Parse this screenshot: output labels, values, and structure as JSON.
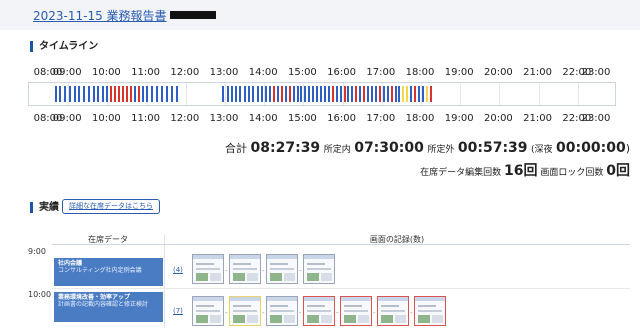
{
  "header": {
    "report_title": "2023-11-15 業務報告書"
  },
  "timeline": {
    "section_title": "タイムライン",
    "hours": [
      "08:00",
      "09:00",
      "10:00",
      "11:00",
      "12:00",
      "13:00",
      "14:00",
      "15:00",
      "16:00",
      "17:00",
      "18:00",
      "19:00",
      "20:00",
      "21:00",
      "22:00",
      "23:00"
    ],
    "stripe_colors": {
      "blue": "#2f5ec4",
      "red": "#d9342b",
      "yellow": "#f2d64b"
    }
  },
  "summary": {
    "total_label": "合計",
    "total_value": "08:27:39",
    "in_hours_label": "所定内",
    "in_hours_value": "07:30:00",
    "out_hours_label": "所定外",
    "out_hours_value": "00:57:39",
    "night_prefix": "(深夜",
    "night_value": "00:00:00",
    "night_suffix": ")",
    "edit_label": "在席データ編集回数",
    "edit_value": "16回",
    "lock_label": "画面ロック回数",
    "lock_value": "0回"
  },
  "results": {
    "section_title": "実績",
    "detail_link": "詳細な在席データはこちら",
    "col_presence": "在席データ",
    "col_screens": "画面の記録(数)",
    "time_labels": [
      "9:00",
      "10:00"
    ],
    "tasks": [
      {
        "title": "社内会議",
        "desc": "コンサルティング社内定例会議",
        "count": "(4)",
        "thumb_borders": [
          "#9aa6b8",
          "#9aa6b8",
          "#9aa6b8",
          "#9aa6b8"
        ]
      },
      {
        "title": "業務環境改善・効率アップ",
        "desc": "計画書の記載内容確認と修正検討",
        "count": "(7)",
        "thumb_borders": [
          "#9aa6b8",
          "#e8d56a",
          "#9aa6b8",
          "#d9534f",
          "#d9534f",
          "#d9534f",
          "#d9534f"
        ]
      }
    ]
  }
}
